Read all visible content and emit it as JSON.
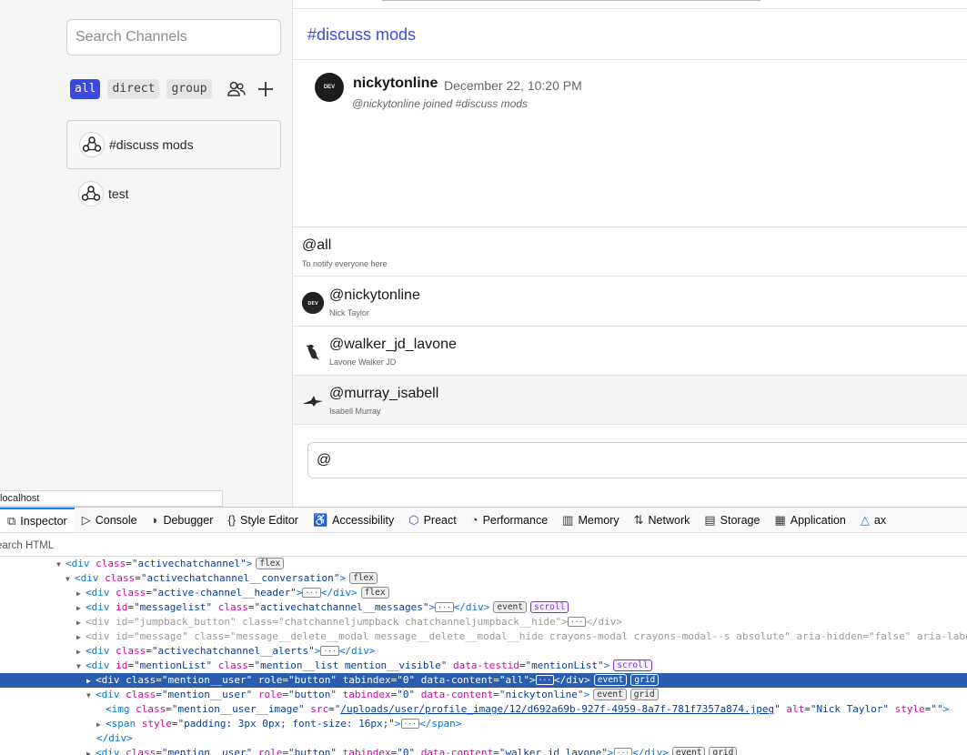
{
  "sidebar": {
    "search_placeholder": "Search Channels",
    "filters": [
      "all",
      "direct",
      "group"
    ],
    "active_filter": "all",
    "channels": [
      {
        "name": "#discuss mods",
        "active": true
      },
      {
        "name": "test",
        "active": false
      }
    ]
  },
  "status_url": "localhost",
  "channel": {
    "title": "#discuss mods",
    "message": {
      "author": "nickytonline",
      "date": "December 22, 10:20 PM",
      "body": "@nickytonline joined #discuss mods",
      "avatar_text": "DEV"
    }
  },
  "mentions": [
    {
      "handle": "@all",
      "name": "To notify everyone here",
      "avatar": "none"
    },
    {
      "handle": "@nickytonline",
      "name": "Nick Taylor",
      "avatar": "dev-avatar"
    },
    {
      "handle": "@walker_jd_lavone",
      "name": "Lavone Walker JD",
      "avatar": "bird"
    },
    {
      "handle": "@murray_isabell",
      "name": "Isabell Murray",
      "avatar": "bird-flying"
    }
  ],
  "composer_value": "@",
  "devtools": {
    "tabs": [
      {
        "label": "Inspector",
        "icon": "inspector-icon",
        "glyph": "⧉",
        "active": true
      },
      {
        "label": "Console",
        "icon": "console-icon",
        "glyph": "▷"
      },
      {
        "label": "Debugger",
        "icon": "debugger-icon",
        "glyph": "◗"
      },
      {
        "label": "Style Editor",
        "icon": "style-editor-icon",
        "glyph": "{}"
      },
      {
        "label": "Accessibility",
        "icon": "accessibility-icon",
        "glyph": "♿"
      },
      {
        "label": "Preact",
        "icon": "preact-icon",
        "glyph": "⬡"
      },
      {
        "label": "Performance",
        "icon": "performance-icon",
        "glyph": "◔"
      },
      {
        "label": "Memory",
        "icon": "memory-icon",
        "glyph": "▥"
      },
      {
        "label": "Network",
        "icon": "network-icon",
        "glyph": "⇅"
      },
      {
        "label": "Storage",
        "icon": "storage-icon",
        "glyph": "▤"
      },
      {
        "label": "Application",
        "icon": "application-icon",
        "glyph": "▦"
      },
      {
        "label": "ax",
        "icon": "axe-icon",
        "glyph": "△"
      }
    ],
    "search_placeholder": "earch HTML",
    "tree": {
      "l1": {
        "tag": "div",
        "cls": "activechatchannel",
        "badge": "flex"
      },
      "l2": {
        "tag": "div",
        "cls": "activechatchannel__conversation",
        "badge": "flex"
      },
      "l3": {
        "tag": "div",
        "cls": "active-channel__header",
        "badge": "flex"
      },
      "l4": {
        "tag": "div",
        "id": "messagelist",
        "cls": "activechatchannel__messages",
        "b1": "event",
        "b2": "scroll"
      },
      "l5": {
        "tag": "div",
        "id": "jumpback_button",
        "cls": "chatchanneljumpback chatchanneljumpback__hide"
      },
      "l6": {
        "tag": "div",
        "id": "message",
        "cls": "message__delete__modal message__delete__modal__hide crayons-modal crayons-modal--s absolute",
        "hidden_attr": "aria-hidden",
        "hidden_val": "false",
        "trail": "aria-labe"
      },
      "l7": {
        "tag": "div",
        "cls": "activechatchannel__alerts"
      },
      "l8": {
        "tag": "div",
        "id": "mentionList",
        "cls": "mention__list mention__visible",
        "testid": "mentionList",
        "badge": "scroll"
      },
      "l9": {
        "tag": "div",
        "cls": "mention__user",
        "role": "button",
        "tabindex": "0",
        "content": "all",
        "b1": "event",
        "b2": "grid"
      },
      "l10": {
        "tag": "div",
        "cls": "mention__user",
        "role": "button",
        "tabindex": "0",
        "content": "nickytonline",
        "b1": "event",
        "b2": "grid"
      },
      "l11": {
        "tag": "img",
        "cls": "mention__user__image",
        "src": "/uploads/user/profile_image/12/d692a69b-927f-4959-8a7f-781f7357a874.jpeg",
        "alt": "Nick Taylor",
        "style": ""
      },
      "l12": {
        "tag": "span",
        "style": "padding: 3px 0px; font-size: 16px;"
      },
      "l13": {
        "tag": "div"
      },
      "l14": {
        "tag": "div",
        "cls": "mention__user",
        "role": "button",
        "tabindex": "0",
        "content": "walker_jd_lavone",
        "b1": "event",
        "b2": "grid"
      }
    }
  }
}
